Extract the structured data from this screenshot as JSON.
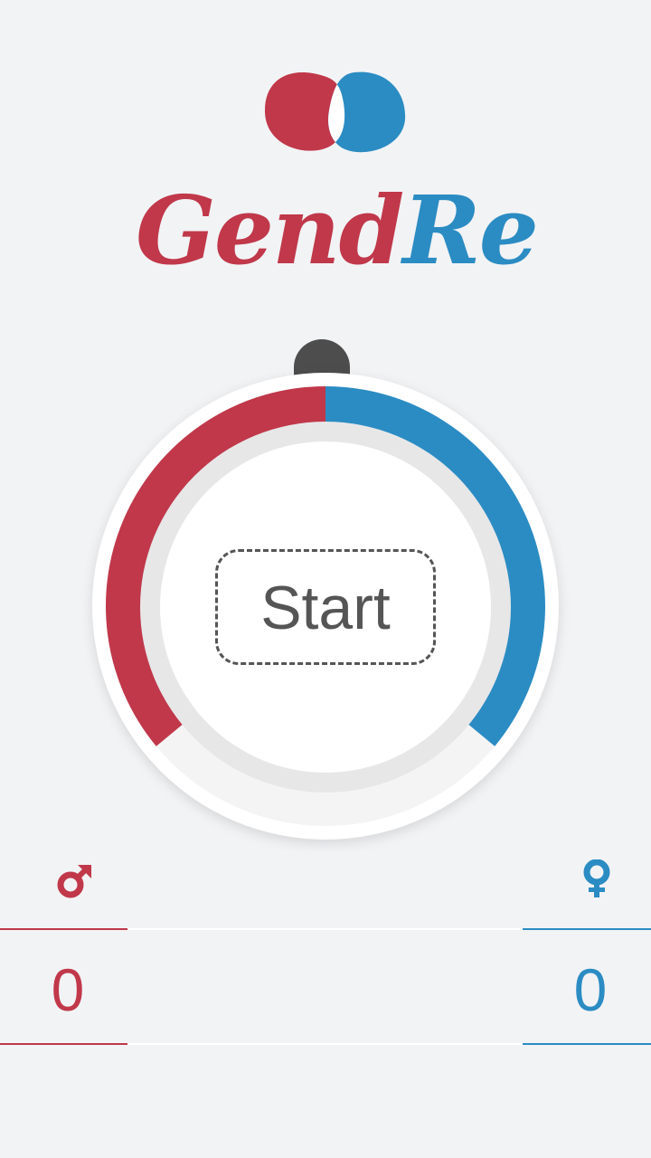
{
  "app": {
    "logo_part_a": "Gend",
    "logo_part_b": "Re"
  },
  "colors": {
    "male": "#c0384a",
    "female": "#2b8cc3",
    "knob": "#4d4d4d",
    "background": "#f2f3f5"
  },
  "dial": {
    "male_fraction": 0.36,
    "female_fraction": 0.36,
    "start_label": "Start"
  },
  "counters": {
    "male_icon": "mars-icon",
    "female_icon": "venus-icon",
    "male_count": "0",
    "female_count": "0"
  }
}
